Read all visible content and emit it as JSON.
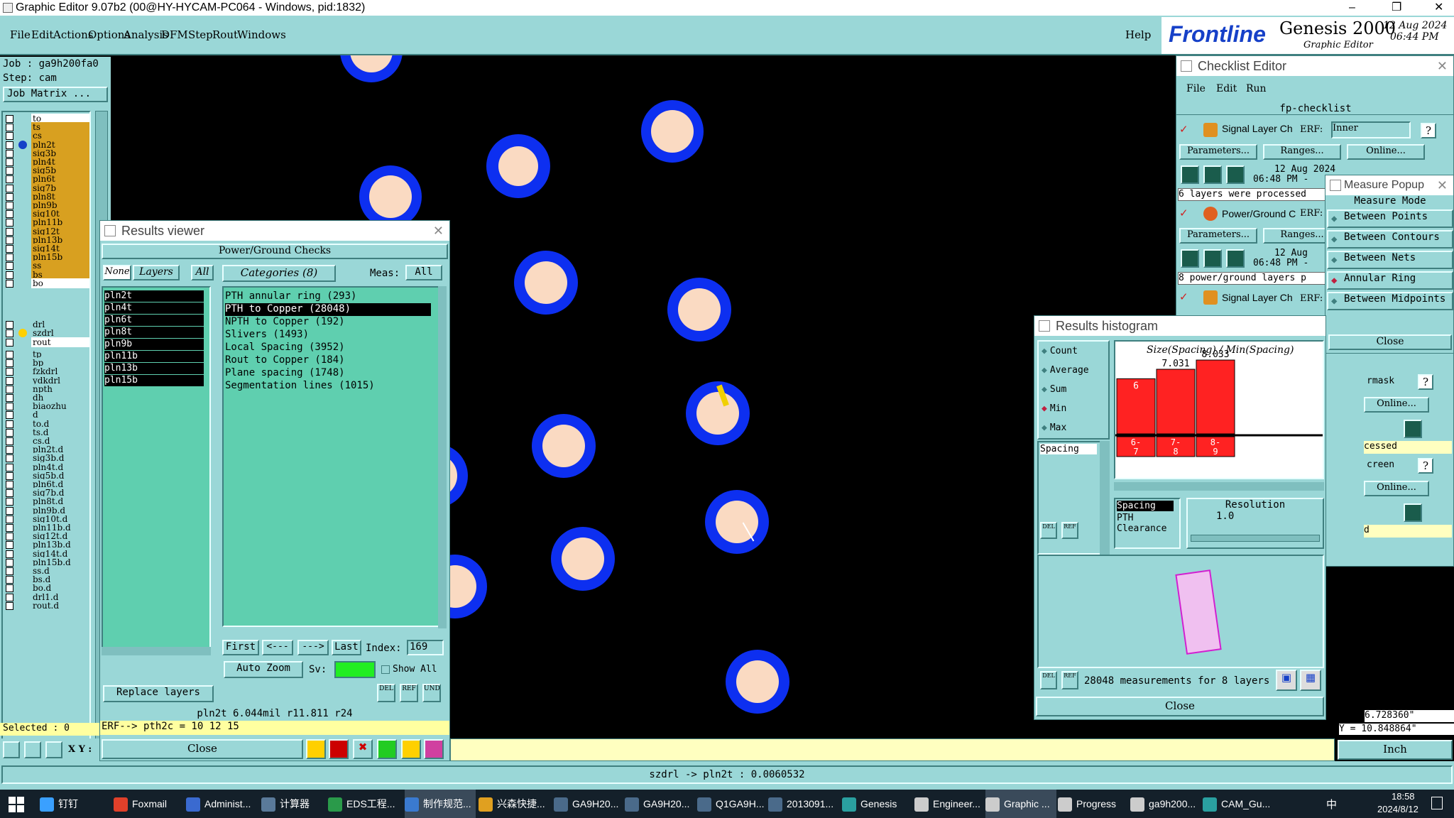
{
  "title_bar": {
    "text": "Graphic Editor 9.07b2 (00@HY-HYCAM-PC064 - Windows, pid:1832)"
  },
  "menu": [
    "File",
    "Edit",
    "Actions",
    "Options",
    "Analysis",
    "DFM",
    "Step",
    "Rout",
    "Windows"
  ],
  "help": "Help",
  "brand": {
    "logo": "Frontline",
    "product": "Genesis 2000",
    "sub": "Graphic Editor",
    "date": "12 Aug 2024",
    "time": "06:44 PM"
  },
  "job": {
    "job": "Job : ga9h200fa0",
    "step": "Step: cam",
    "matrix": "Job Matrix ..."
  },
  "layers_a": [
    {
      "n": "to",
      "c": "#ffffff"
    },
    {
      "n": "ts",
      "c": "#d8a020"
    },
    {
      "n": "cs",
      "c": "#d8a020"
    },
    {
      "n": "pln2t",
      "c": "#d8a020",
      "active": true
    },
    {
      "n": "sig3b",
      "c": "#d8a020"
    },
    {
      "n": "pln4t",
      "c": "#d8a020"
    },
    {
      "n": "sig5b",
      "c": "#d8a020"
    },
    {
      "n": "pln6t",
      "c": "#d8a020"
    },
    {
      "n": "sig7b",
      "c": "#d8a020"
    },
    {
      "n": "pln8t",
      "c": "#d8a020"
    },
    {
      "n": "pln9b",
      "c": "#d8a020"
    },
    {
      "n": "sig10t",
      "c": "#d8a020"
    },
    {
      "n": "pln11b",
      "c": "#d8a020"
    },
    {
      "n": "sig12t",
      "c": "#d8a020"
    },
    {
      "n": "pln13b",
      "c": "#d8a020"
    },
    {
      "n": "sig14t",
      "c": "#d8a020"
    },
    {
      "n": "pln15b",
      "c": "#d8a020"
    },
    {
      "n": "ss",
      "c": "#d8a020"
    },
    {
      "n": "bs",
      "c": "#d8a020"
    },
    {
      "n": "bo",
      "c": "#ffffff"
    }
  ],
  "layers_b": [
    {
      "n": "drl",
      "c": "#9ad7d7"
    },
    {
      "n": "szdrl",
      "c": "#9ad7d7",
      "dot": "#ffd000"
    },
    {
      "n": "rout",
      "c": "#ffffff"
    }
  ],
  "layers_c": [
    "tp",
    "bp",
    "fzkdrl",
    "ydkdrl",
    "npth",
    "dh",
    "biaozhu",
    "d",
    "to.d",
    "ts.d",
    "cs.d",
    "pln2t.d",
    "sig3b.d",
    "pln4t.d",
    "sig5b.d",
    "pln6t.d",
    "sig7b.d",
    "pln8t.d",
    "pln9b.d",
    "sig10t.d",
    "pln11b.d",
    "sig12t.d",
    "pln13b.d",
    "sig14t.d",
    "pln15b.d",
    "ss.d",
    "bs.d",
    "bo.d",
    "drl1.d",
    "rout.d"
  ],
  "selected": "Selected : 0",
  "xy_label": "X Y :",
  "results_viewer": {
    "title": "Results viewer",
    "header": "Power/Ground Checks",
    "none": "None",
    "layers": "Layers",
    "all": "All",
    "categories": "Categories (8)",
    "meas": "Meas:",
    "meas_val": "All",
    "layer_list": [
      "pln2t",
      "pln4t",
      "pln6t",
      "pln8t",
      "pln9b",
      "pln11b",
      "pln13b",
      "pln15b"
    ],
    "cat_list": [
      "PTH annular ring (293)",
      "PTH to Copper (28048)",
      "NPTH to Copper (192)",
      "Slivers (1493)",
      "Local Spacing (3952)",
      "Rout to Copper (184)",
      "Plane spacing (1748)",
      "Segmentation lines (1015)"
    ],
    "first": "First",
    "prev": "<---",
    "next": "--->",
    "last": "Last",
    "index_label": "Index:",
    "index_val": "169",
    "auto_zoom": "Auto Zoom",
    "sv": "Sv:",
    "show_all": "Show All",
    "replace": "Replace layers",
    "status": "pln2t 6.044mil r11.811 r24",
    "erf": "ERF--> pth2c = 10 12 15",
    "close": "Close"
  },
  "checklist": {
    "title": "Checklist Editor",
    "menu": [
      "File",
      "Edit",
      "Run"
    ],
    "name": "fp-checklist",
    "rows": [
      {
        "name": "Signal Layer Ch",
        "erf": "ERF:",
        "erf_val": "Inner",
        "params": "Parameters...",
        "ranges": "Ranges...",
        "online": "Online...",
        "date": "12 Aug 2024",
        "time": "06:48 PM -",
        "msg": "6 layers were processed"
      },
      {
        "name": "Power/Ground C",
        "erf": "ERF:",
        "params": "Parameters...",
        "ranges": "Ranges...",
        "date": "12 Aug",
        "time": "06:48 PM -",
        "msg": "8 power/ground layers p"
      },
      {
        "name": "Signal Layer Ch",
        "erf": "ERF:"
      }
    ],
    "partial": {
      "mask": "rmask",
      "online1": "Online...",
      "cessed": "cessed",
      "creen": "creen",
      "online2": "Online...",
      "d": "d"
    }
  },
  "measure": {
    "title": "Measure Popup",
    "mode": "Measure Mode",
    "opts": [
      "Between Points",
      "Between Contours",
      "Between Nets",
      "Annular Ring",
      "Between Midpoints"
    ],
    "selected": 3,
    "close": "Close"
  },
  "histogram": {
    "title": "Results histogram",
    "opts": [
      "Count",
      "Average",
      "Sum",
      "Min",
      "Max"
    ],
    "selected": 3,
    "spacing_tag": "Spacing",
    "chart_title": "Size(Spacing) / Min(Spacing)",
    "chart_data": {
      "type": "bar",
      "categories": [
        "6-7",
        "7-8",
        "8-9"
      ],
      "values": [
        6,
        7.031,
        8.033
      ],
      "value_labels": [
        "6",
        "7.031",
        "8.033"
      ],
      "ylim": [
        0,
        8.5
      ]
    },
    "sel": "Spacing",
    "pth": "PTH",
    "clearance": "Clearance",
    "resolution": "Resolution",
    "res_val": "1.0",
    "status": "28048 measurements for 8 layers",
    "close": "Close"
  },
  "coords": {
    "x": "6.728360\"",
    "y": "Y = 10.848864\""
  },
  "units": "Inch",
  "bottom_status": "szdrl -> pln2t : 0.0060532",
  "taskbar": {
    "items": [
      "钉钉",
      "Foxmail",
      "Administ...",
      "计算器",
      "EDS工程...",
      "制作规范...",
      "兴森快捷...",
      "GA9H20...",
      "GA9H20...",
      "Q1GA9H...",
      "2013091...",
      "Genesis",
      "Engineer...",
      "Graphic ...",
      "Progress",
      "ga9h200...",
      "CAM_Gu..."
    ],
    "tray": "中",
    "time": "18:58",
    "date": "2024/8/12"
  },
  "colors": {
    "teal": "#9ad7d7",
    "pad": "#0d2ff0",
    "pad_center": "#fadac2",
    "layer_active": "#d8a020",
    "bar": "#ff2222",
    "histo_list": "#5fcfaf"
  }
}
